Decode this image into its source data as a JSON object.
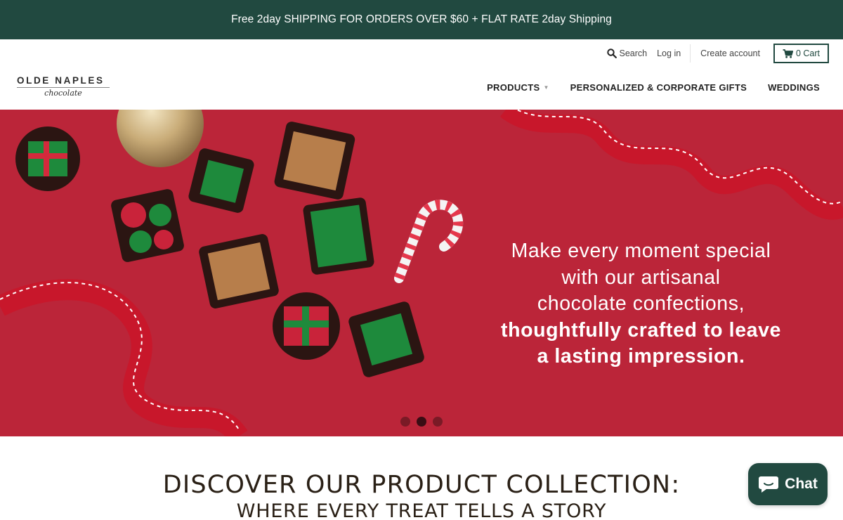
{
  "announcement": {
    "text": "Free 2day SHIPPING FOR ORDERS OVER $60 + FLAT RATE 2day Shipping"
  },
  "header": {
    "links": {
      "search": "Search",
      "login": "Log in",
      "create_account": "Create account",
      "cart": "0 Cart"
    },
    "logo": {
      "line1": "OLDE NAPLES",
      "line2": "chocolate"
    },
    "nav": [
      {
        "label": "PRODUCTS"
      },
      {
        "label": "PERSONALIZED & CORPORATE GIFTS"
      },
      {
        "label": "WEDDINGS"
      }
    ]
  },
  "hero": {
    "text_light": [
      "Make every moment special",
      "with our artisanal",
      "chocolate confections,"
    ],
    "text_bold": [
      "thoughtfully crafted to leave",
      "a lasting impression."
    ],
    "slides": 3,
    "active_slide": 2
  },
  "discover": {
    "title": "DISCOVER OUR PRODUCT COLLECTION:",
    "subtitle": "WHERE EVERY TREAT TELLS A STORY"
  },
  "chat": {
    "label": "Chat"
  },
  "colors": {
    "brand_green": "#214940",
    "hero_red": "#bb2539",
    "text_dark": "#2a2016"
  }
}
